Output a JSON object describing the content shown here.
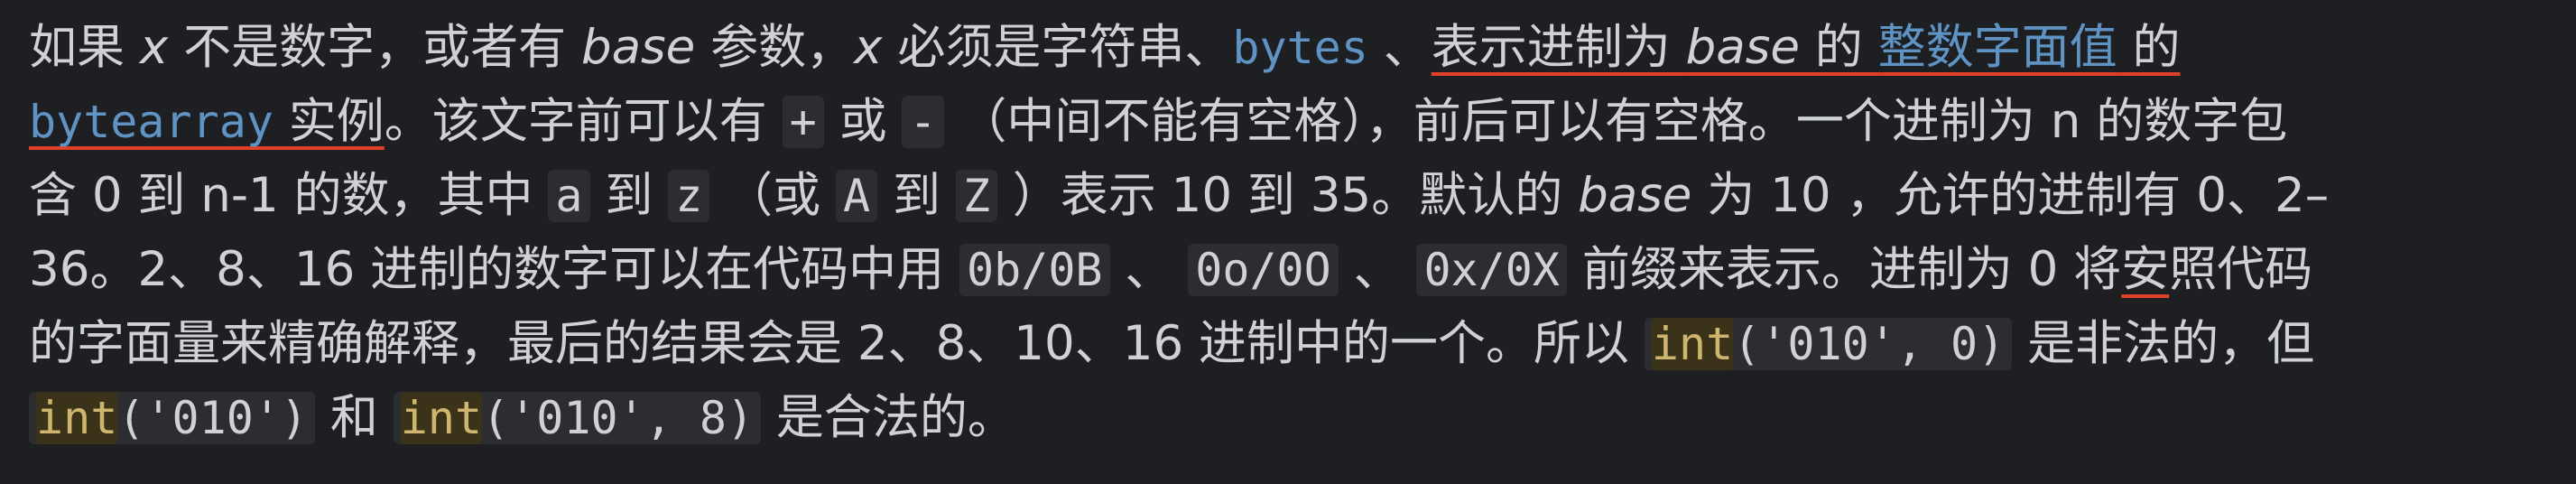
{
  "lines": [
    [
      {
        "t": "如果 "
      },
      {
        "t": "x",
        "s": "em"
      },
      {
        "t": " 不是数字，或者有 "
      },
      {
        "t": "base",
        "s": "em"
      },
      {
        "t": " 参数，"
      },
      {
        "t": "x",
        "s": "em"
      },
      {
        "t": " 必须是字符串、"
      },
      {
        "t": "bytes",
        "s": "code-link"
      },
      {
        "t": " 、"
      },
      {
        "t": "表示进制为 ",
        "u": true
      },
      {
        "t": "base",
        "s": "em",
        "u": true
      },
      {
        "t": " 的 ",
        "u": true
      },
      {
        "t": "整数字面值",
        "s": "link",
        "u": true
      },
      {
        "t": " 的",
        "u": true
      }
    ],
    [
      {
        "t": "bytearray",
        "s": "code-link",
        "u": true
      },
      {
        "t": " 实例",
        "u": true
      },
      {
        "t": "。该文字前可以有 "
      },
      {
        "t": "+",
        "s": "code"
      },
      {
        "t": " 或 "
      },
      {
        "t": "-",
        "s": "code"
      },
      {
        "t": " （中间不能有空格），前后可以有空格。一个进制为 n 的数字包"
      }
    ],
    [
      {
        "t": "含 0 到 n-1 的数，其中 "
      },
      {
        "t": "a",
        "s": "code"
      },
      {
        "t": " 到 "
      },
      {
        "t": "z",
        "s": "code"
      },
      {
        "t": " （或 "
      },
      {
        "t": "A",
        "s": "code"
      },
      {
        "t": " 到 "
      },
      {
        "t": "Z",
        "s": "code"
      },
      {
        "t": " ）表示 10 到 35。默认的 "
      },
      {
        "t": "base",
        "s": "em"
      },
      {
        "t": " 为 10 ，允许的进制有 0、2–"
      }
    ],
    [
      {
        "t": "36。2、8、16 进制的数字可以在代码中用 "
      },
      {
        "t": "0b/0B",
        "s": "code"
      },
      {
        "t": " 、 "
      },
      {
        "t": "0o/0O",
        "s": "code"
      },
      {
        "t": " 、 "
      },
      {
        "t": "0x/0X",
        "s": "code"
      },
      {
        "t": " 前缀来表示。进制为 0 将"
      },
      {
        "t": "安",
        "u": true
      },
      {
        "t": "照代码"
      }
    ],
    [
      {
        "t": "的字面量来精确解释，最后的结果会是 2、8、10、16 进制中的一个。所以 "
      },
      {
        "code": [
          {
            "t": "int",
            "kw": true
          },
          {
            "t": "('010', 0)"
          }
        ]
      },
      {
        "t": " 是非法的，但"
      }
    ],
    [
      {
        "code": [
          {
            "t": "int",
            "kw": true
          },
          {
            "t": "('010')"
          }
        ]
      },
      {
        "t": " 和 "
      },
      {
        "code": [
          {
            "t": "int",
            "kw": true
          },
          {
            "t": "('010', 8)"
          }
        ]
      },
      {
        "t": " 是合法的。"
      }
    ]
  ]
}
